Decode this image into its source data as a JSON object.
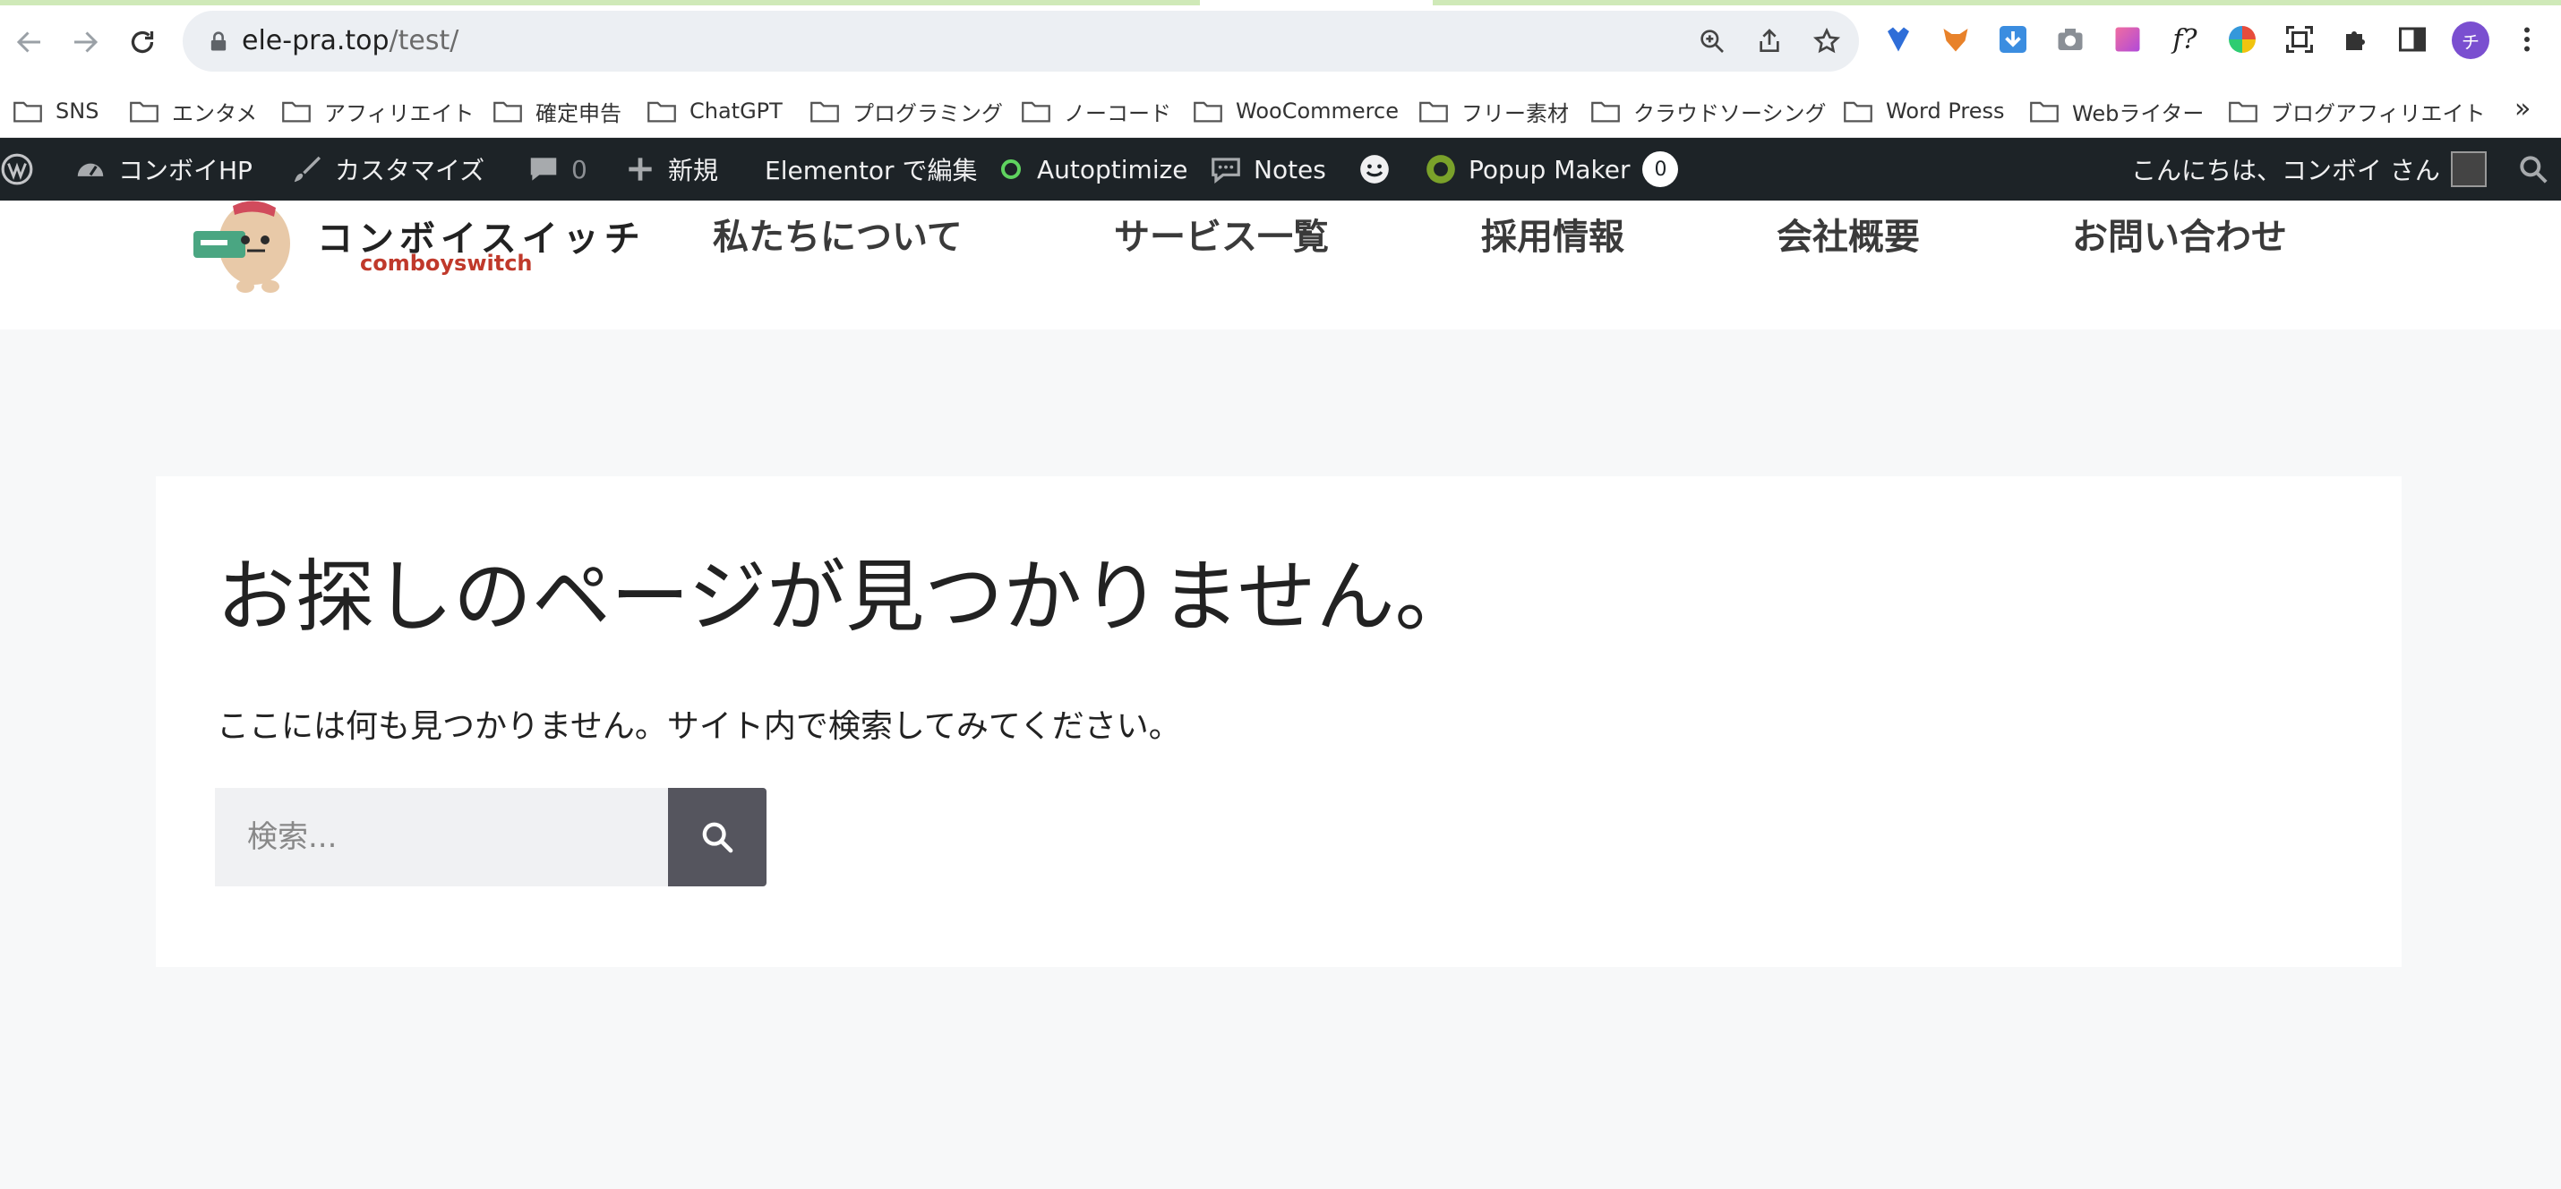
{
  "browser": {
    "url_host": "ele-pra.top",
    "url_path": "/test/",
    "avatar_initial": "チ"
  },
  "bookmarks": [
    "SNS",
    "エンタメ",
    "アフィリエイト",
    "確定申告",
    "ChatGPT",
    "プログラミング",
    "ノーコード",
    "WooCommerce",
    "フリー素材",
    "クラウドソーシング",
    "Word Press",
    "Webライター",
    "ブログアフィリエイト"
  ],
  "bookmarks_more": "»",
  "wp_admin": {
    "site_name": "コンボイHP",
    "customize": "カスタマイズ",
    "comments_count": "0",
    "new": "新規",
    "elementor": "Elementor で編集",
    "autoptimize": "Autoptimize",
    "notes": "Notes",
    "popup_maker": "Popup Maker",
    "popup_count": "0",
    "greeting": "こんにちは、コンボイ さん"
  },
  "site": {
    "logo_jp": "コンボイスイッチ",
    "logo_en": "comboyswitch",
    "menu": [
      "私たちについて",
      "サービス一覧",
      "採用情報",
      "会社概要",
      "お問い合わせ"
    ]
  },
  "content": {
    "title": "お探しのページが見つかりません。",
    "description": "ここには何も見つかりません。サイト内で検索してみてください。",
    "search_placeholder": "検索..."
  },
  "colors": {
    "admin_bar": "#1d2327",
    "search_button": "#55555e",
    "page_background": "#f7f8f9"
  }
}
